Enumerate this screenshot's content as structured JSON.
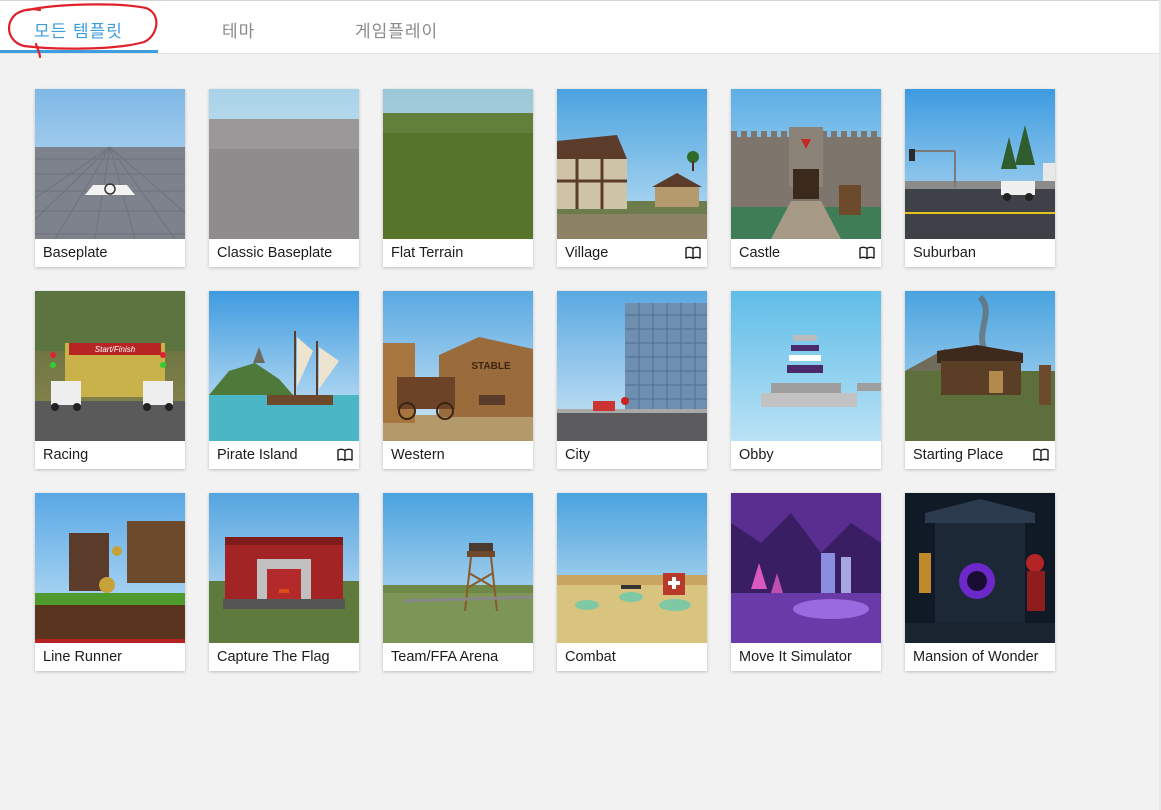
{
  "tabs": [
    {
      "label": "모든 템플릿",
      "active": true
    },
    {
      "label": "테마",
      "active": false
    },
    {
      "label": "게임플레이",
      "active": false
    }
  ],
  "colors": {
    "accent": "#3d9ddf",
    "annotation": "#e0202a"
  },
  "templates": [
    {
      "name": "Baseplate",
      "tutorial": false
    },
    {
      "name": "Classic Baseplate",
      "tutorial": false
    },
    {
      "name": "Flat Terrain",
      "tutorial": false
    },
    {
      "name": "Village",
      "tutorial": true
    },
    {
      "name": "Castle",
      "tutorial": true
    },
    {
      "name": "Suburban",
      "tutorial": false
    },
    {
      "name": "Racing",
      "tutorial": false
    },
    {
      "name": "Pirate Island",
      "tutorial": true
    },
    {
      "name": "Western",
      "tutorial": false
    },
    {
      "name": "City",
      "tutorial": false
    },
    {
      "name": "Obby",
      "tutorial": false
    },
    {
      "name": "Starting Place",
      "tutorial": true
    },
    {
      "name": "Line Runner",
      "tutorial": false
    },
    {
      "name": "Capture The Flag",
      "tutorial": false
    },
    {
      "name": "Team/FFA Arena",
      "tutorial": false
    },
    {
      "name": "Combat",
      "tutorial": false
    },
    {
      "name": "Move It Simulator",
      "tutorial": false
    },
    {
      "name": "Mansion of Wonder",
      "tutorial": false
    }
  ],
  "thumb_text": {
    "racing_banner": "Start/Finish",
    "western_sign": "STABLE"
  },
  "icons": {
    "tutorial": "book-icon"
  }
}
